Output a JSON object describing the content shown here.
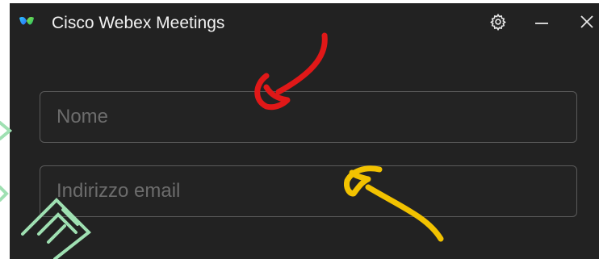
{
  "window": {
    "title": "Cisco Webex Meetings",
    "app_icon": "webex-logo",
    "controls": [
      {
        "name": "settings",
        "icon": "gear-icon"
      },
      {
        "name": "minimize",
        "icon": "minimize-icon"
      },
      {
        "name": "close",
        "icon": "close-icon"
      }
    ]
  },
  "form": {
    "name_field": {
      "placeholder": "Nome",
      "value": ""
    },
    "email_field": {
      "placeholder": "Indirizzo email",
      "value": ""
    }
  },
  "annotations": {
    "arrow_red": {
      "color": "#e01818",
      "points_to": "name-field"
    },
    "arrow_yellow": {
      "color": "#f2c200",
      "points_to": "email-field"
    }
  },
  "colors": {
    "background": "#222222",
    "field_border": "#5a5a5a",
    "placeholder": "#6c6c6c",
    "watermark": "#9fe0b2"
  }
}
